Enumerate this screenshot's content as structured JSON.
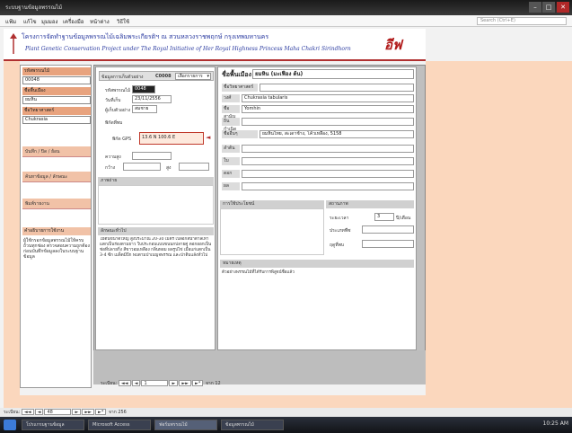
{
  "window": {
    "title": "ระบบฐานข้อมูลพรรณไม้",
    "search_placeholder": "Search (Ctrl+E)",
    "min_label": "–",
    "max_label": "□",
    "close_label": "✕"
  },
  "menu": [
    "แฟ้ม",
    "แก้ไข",
    "มุมมอง",
    "เครื่องมือ",
    "หน้าต่าง",
    "วิธีใช้"
  ],
  "header": {
    "thai_title": "โครงการจัดทำฐานข้อมูลพรรณไม้เฉลิมพระเกียรติฯ ณ สวนหลวงราชพฤกษ์ กรุงเทพมหานคร",
    "eng_title": "Plant Genetic Conservation Project under The Royal Initiative of Her Royal Highness Princess Maha Chakri Sirindhorn",
    "logo_text": "อีฟ"
  },
  "sidebar": {
    "field1_label": "รหัสพรรณไม้",
    "field1_value": "00048",
    "field2_label": "ชื่อพื้นเมือง",
    "field2_value": "ยมหิน",
    "field3_label": "ชื่อวิทยาศาสตร์",
    "field3_value": "Chukrasia",
    "btn1": "บันทึก / ปิด / ย้อน",
    "btn2": "ค้นหาข้อมูล / ลักษณะ",
    "btn3": "พิมพ์รายงาน",
    "note_title": "คำอธิบายการใช้งาน",
    "note_text": "ผู้ใช้กรอกข้อมูลพรรณไม้ให้ครบถ้วนทุกช่อง ตรวจสอบความถูกต้องก่อนบันทึกข้อมูลลงในระบบฐานข้อมูล"
  },
  "form_left": {
    "topbar_label": "ข้อมูลการเก็บตัวอย่าง",
    "topbar_code": "C0008",
    "topbar_dropdown": "เลือกรายการ",
    "code_label": "รหัสพรรณไม้",
    "code_value": "0048",
    "date_label": "วันที่เก็บ",
    "date_value": "23/11/2556",
    "collector_label": "ผู้เก็บตัวอย่าง",
    "collector_value": "สมชาย",
    "location_label": "พิกัดที่พบ",
    "gps_label": "พิกัด GPS",
    "gps_value": "13.6 N 100.6 E",
    "alt_label": "ความสูง",
    "width_label": "กว้าง",
    "height_label": "สูง",
    "photo_head": "ภาพถ่าย",
    "desc_head": "ลักษณะทั่วไป",
    "desc_text": "ไม้ต้นขนาดใหญ่ สูงประมาณ 20-30 เมตร เปลือกสีน้ำตาลเทา แตกเป็นร่องตามยาว ใบประกอบแบบขนนกปลายคู่ ดอกออกเป็นช่อที่ปลายกิ่ง สีขาวอมเหลือง กลิ่นหอม ผลรูปไข่ เมื่อแก่แตกเป็น 3-4 ซีก เมล็ดมีปีก พบตามป่าเบญจพรรณ และป่าดิบแล้งทั่วไป"
  },
  "form_right": {
    "title_label": "ชื่อพื้นเมือง",
    "title_value": "ยมหิน (มะเฟือง ต้น)",
    "row1_label": "ชื่อวิทยาศาสตร์",
    "row2_label": "วงศ์",
    "row2_value": "Chukrasia tabularis",
    "row3_label": "ชื่อสามัญ",
    "row3_value": "Yomhin",
    "row4_label": "ถิ่นกำเนิด",
    "row5_label": "ชื่ออื่นๆ",
    "row5_value": "ยมหินไทย, สะเดาช้าง, โค้วเหลือง, 5158",
    "row6_label": "ลำต้น",
    "row7_label": "ใบ",
    "row8_label": "ดอก",
    "row9_label": "ผล",
    "usage_head": "การใช้ประโยชน์",
    "status_head": "สถานภาพ",
    "status1_label": "ระยะเวลา",
    "status1_value": "3",
    "status1_unit": "ปี/เดือน",
    "status2_label": "ประเภทพืช",
    "status3_label": "ฤดูที่พบ",
    "remark_head": "หมายเหตุ",
    "remark_text": "ตัวอย่างพรรณไม้ที่ได้รับการพิสูจน์ชื่อแล้ว"
  },
  "recnav": {
    "label": "ระเบียน:",
    "first": "◄◄",
    "prev": "◄",
    "current": "1",
    "next": "►",
    "last": "►►",
    "new": "►*",
    "total": "จาก 12"
  },
  "statusbar": {
    "label": "ระเบียน:",
    "first": "◄◄",
    "prev": "◄",
    "current": "48",
    "next": "►",
    "last": "►►",
    "new": "►*",
    "total": "จาก 256"
  },
  "taskbar": {
    "items": [
      "โปรแกรมฐานข้อมูล",
      "Microsoft Access",
      "ฟอร์มพรรณไม้",
      "ข้อมูลพรรณไม้"
    ],
    "clock": "10:25 AM"
  },
  "colors": {
    "accent_salmon": "#fbd7bd",
    "label_orange": "#e8a37e",
    "header_blue": "#2a3aa0",
    "logo_red": "#b01818"
  }
}
